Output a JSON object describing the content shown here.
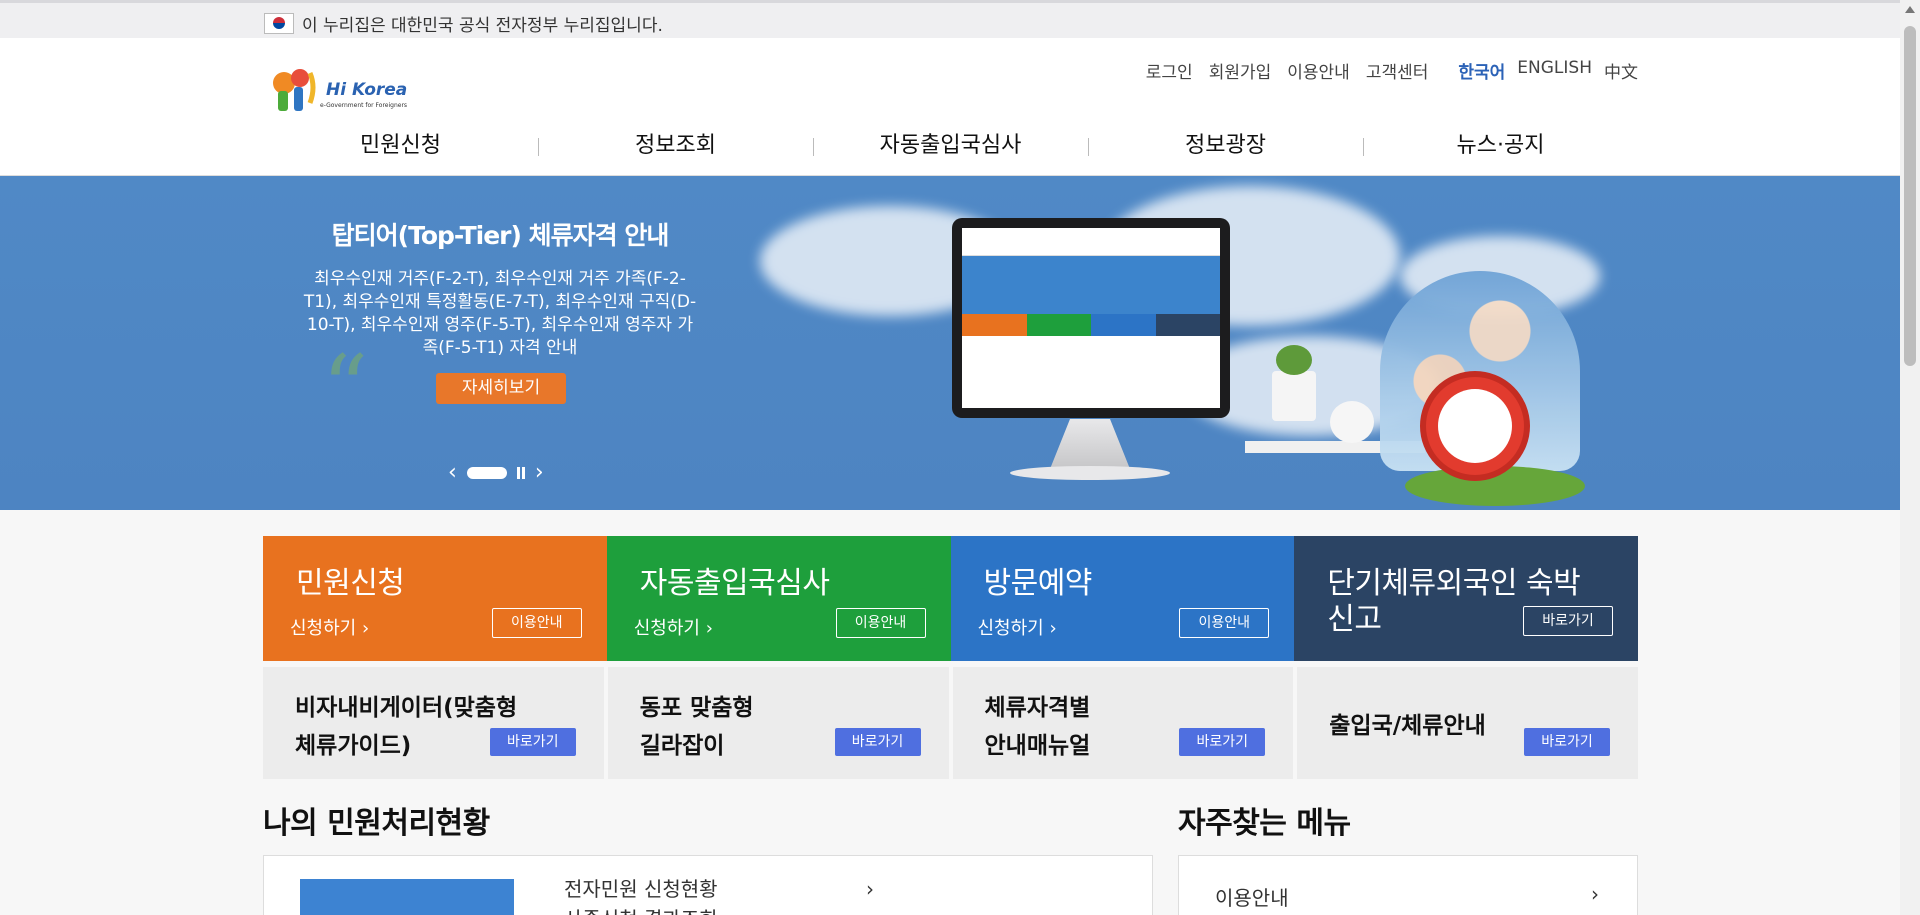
{
  "gov_notice": "이 누리집은 대한민국 공식 전자정부 누리집입니다.",
  "logo": {
    "main": "Hi Korea",
    "sub": "e-Government for Foreigners"
  },
  "util_menu": [
    "로그인",
    "회원가입",
    "이용안내",
    "고객센터"
  ],
  "languages": [
    "한국어",
    "ENGLISH",
    "中文"
  ],
  "gnb": [
    "민원신청",
    "정보조회",
    "자동출입국심사",
    "정보광장",
    "뉴스·공지"
  ],
  "banner": {
    "title": "탑티어(Top-Tier) 체류자격 안내",
    "description": "최우수인재 거주(F-2-T), 최우수인재 거주 가족(F-2-T1), 최우수인재 특정활동(E-7-T), 최우수인재 구직(D-10-T), 최우수인재 영주(F-5-T), 최우수인재 영주자 가족(F-5-T1) 자격 안내",
    "button": "자세히보기"
  },
  "quick_tiles": [
    {
      "title": "민원신청",
      "sub": "신청하기",
      "button": "이용안내"
    },
    {
      "title": "자동출입국심사",
      "sub": "신청하기",
      "button": "이용안내"
    },
    {
      "title": "방문예약",
      "sub": "신청하기",
      "button": "이용안내"
    },
    {
      "title": "단기체류외국인 숙박신고",
      "title_line1": "단기체류외국인 숙박",
      "title_line2": "신고",
      "button": "바로가기"
    }
  ],
  "info_tiles": [
    {
      "line1": "비자내비게이터(맞춤형",
      "line2": "체류가이드)",
      "button": "바로가기"
    },
    {
      "line1": "동포 맞춤형",
      "line2": "길라잡이",
      "button": "바로가기"
    },
    {
      "line1": "체류자격별",
      "line2": "안내매뉴얼",
      "button": "바로가기"
    },
    {
      "line1": "출입국/체류안내",
      "line2": "",
      "button": "바로가기"
    }
  ],
  "my_status": {
    "title": "나의 민원처리현황",
    "links": [
      "전자민원 신청현황",
      "사증신청 결과조회"
    ]
  },
  "favorites": {
    "title": "자주찾는 메뉴",
    "items": [
      "이용안내"
    ]
  },
  "colors": {
    "orange": "#e8721f",
    "green": "#1e9f3c",
    "blue": "#2c74c6",
    "navy": "#2b4464",
    "banner": "#4f87c4"
  }
}
